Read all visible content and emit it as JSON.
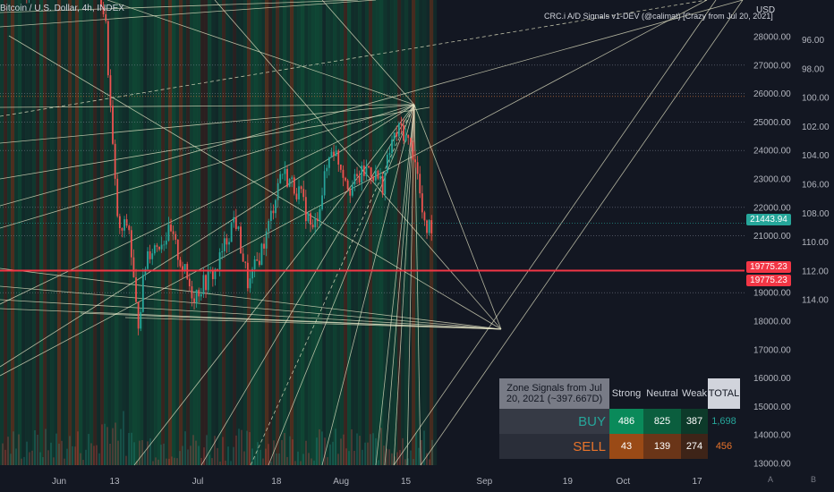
{
  "header": {
    "title": "Bitcoin / U.S. Dollar, 4h, INDEX",
    "indicator": "CRC.i A/D Signals v1-DEV (@calimat) [Crazy from Jul 20, 2021]",
    "currency": "USD"
  },
  "chart_data": {
    "type": "candlestick",
    "y_left_ticks": [
      28000,
      27000,
      26000,
      25000,
      24000,
      23000,
      22000,
      21000,
      20000,
      19000,
      18000,
      17000,
      16000,
      15000,
      14000,
      13000
    ],
    "y_left_tick_labels": [
      "28000.00",
      "27000.00",
      "26000.00",
      "25000.00",
      "24000.00",
      "23000.00",
      "22000.00",
      "21000.00",
      "20000.00",
      "19000.00",
      "18000.00",
      "17000.00",
      "16000.00",
      "15000.00",
      "14000.00",
      "13000.00"
    ],
    "y_right_ticks": [
      "96.00",
      "98.00",
      "100.00",
      "102.00",
      "104.00",
      "106.00",
      "108.00",
      "110.00",
      "112.00",
      "114.00"
    ],
    "x_ticks": [
      "Jun",
      "13",
      "Jul",
      "18",
      "Aug",
      "15",
      "Sep",
      "19",
      "Oct",
      "17"
    ],
    "x_tick_dates": [
      "2022-06-01",
      "2022-06-13",
      "2022-07-01",
      "2022-07-18",
      "2022-08-01",
      "2022-08-15",
      "2022-09-01",
      "2022-09-19",
      "2022-10-01",
      "2022-10-17"
    ],
    "price_path": [
      {
        "x": "2022-05-25",
        "y": 29600
      },
      {
        "x": "2022-05-31",
        "y": 31500
      },
      {
        "x": "2022-06-06",
        "y": 30500
      },
      {
        "x": "2022-06-09",
        "y": 30100
      },
      {
        "x": "2022-06-11",
        "y": 28600
      },
      {
        "x": "2022-06-13",
        "y": 23000
      },
      {
        "x": "2022-06-14",
        "y": 21000
      },
      {
        "x": "2022-06-16",
        "y": 21500
      },
      {
        "x": "2022-06-18",
        "y": 17800
      },
      {
        "x": "2022-06-20",
        "y": 20400
      },
      {
        "x": "2022-06-25",
        "y": 21100
      },
      {
        "x": "2022-06-30",
        "y": 18900
      },
      {
        "x": "2022-07-05",
        "y": 19800
      },
      {
        "x": "2022-07-09",
        "y": 21700
      },
      {
        "x": "2022-07-12",
        "y": 19200
      },
      {
        "x": "2022-07-16",
        "y": 21100
      },
      {
        "x": "2022-07-19",
        "y": 23300
      },
      {
        "x": "2022-07-23",
        "y": 22500
      },
      {
        "x": "2022-07-26",
        "y": 21100
      },
      {
        "x": "2022-07-30",
        "y": 24200
      },
      {
        "x": "2022-08-03",
        "y": 22700
      },
      {
        "x": "2022-08-07",
        "y": 23400
      },
      {
        "x": "2022-08-10",
        "y": 22800
      },
      {
        "x": "2022-08-12",
        "y": 24300
      },
      {
        "x": "2022-08-14",
        "y": 24800
      },
      {
        "x": "2022-08-17",
        "y": 23800
      },
      {
        "x": "2022-08-19",
        "y": 21200
      },
      {
        "x": "2022-08-21",
        "y": 21443.94
      }
    ],
    "last_price": 21443.94,
    "last_price_label": "21443.94",
    "horizontal_levels": [
      19775.23
    ],
    "level_labels": [
      "19775.23",
      "19775.23"
    ],
    "signal_table": {
      "header": [
        "Zone Signals from Jul 20, 2021 (~397.667D)",
        "Strong",
        "Neutral",
        "Weak",
        "TOTAL"
      ],
      "rows": [
        {
          "label": "BUY",
          "strong": "486",
          "neutral": "825",
          "weak": "387",
          "total": "1,698"
        },
        {
          "label": "SELL",
          "strong": "43",
          "neutral": "139",
          "weak": "274",
          "total": "456"
        }
      ]
    },
    "colors": {
      "background": "#131722",
      "up": "#26a69a",
      "down": "#ef5350",
      "level": "#f23645",
      "fan_line": "#e8e8c8",
      "buy_zone": "#0e5a3c",
      "sell_zone": "#6b3a1e"
    }
  },
  "footer": {
    "btn_a": "A",
    "btn_b": "B"
  }
}
